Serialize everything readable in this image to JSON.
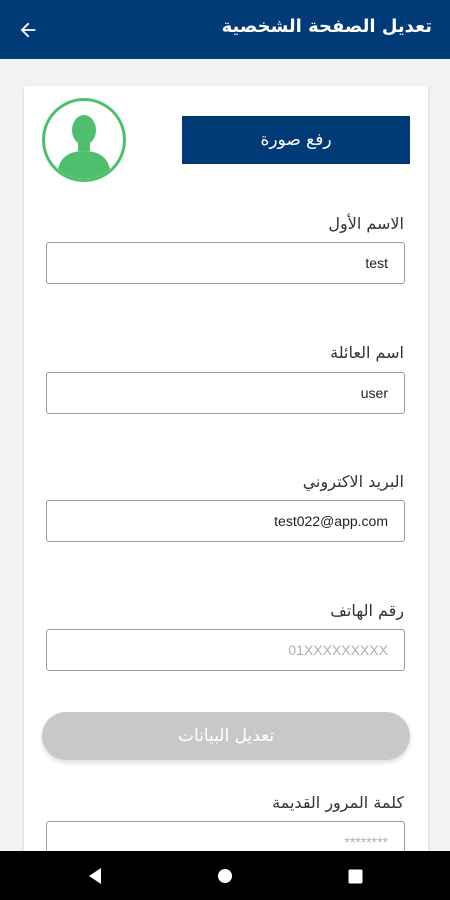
{
  "appbar": {
    "title": "تعديل الصفحة الشخصية",
    "back_icon": "arrow-left-icon",
    "background": "#003b78"
  },
  "profile": {
    "avatar_icon": "user-silhouette-icon",
    "avatar_color": "#4fbf6e",
    "upload_label": "رفع صورة"
  },
  "fields": {
    "first_name": {
      "label": "الاسم الأول",
      "value": "test",
      "placeholder": ""
    },
    "last_name": {
      "label": "اسم العائلة",
      "value": "user",
      "placeholder": ""
    },
    "email": {
      "label": "البريد الاكتروني",
      "value": "test022@app.com",
      "placeholder": ""
    },
    "phone": {
      "label": "رقم الهاتف",
      "value": "",
      "placeholder": "01XXXXXXXXX"
    },
    "old_password": {
      "label": "كلمة المرور القديمة",
      "value": "",
      "placeholder": "********"
    }
  },
  "submit": {
    "label": "تعديل البيانات",
    "state": "disabled"
  },
  "navbar": {
    "back_icon": "nav-back-icon",
    "home_icon": "nav-home-icon",
    "recents_icon": "nav-recents-icon"
  }
}
